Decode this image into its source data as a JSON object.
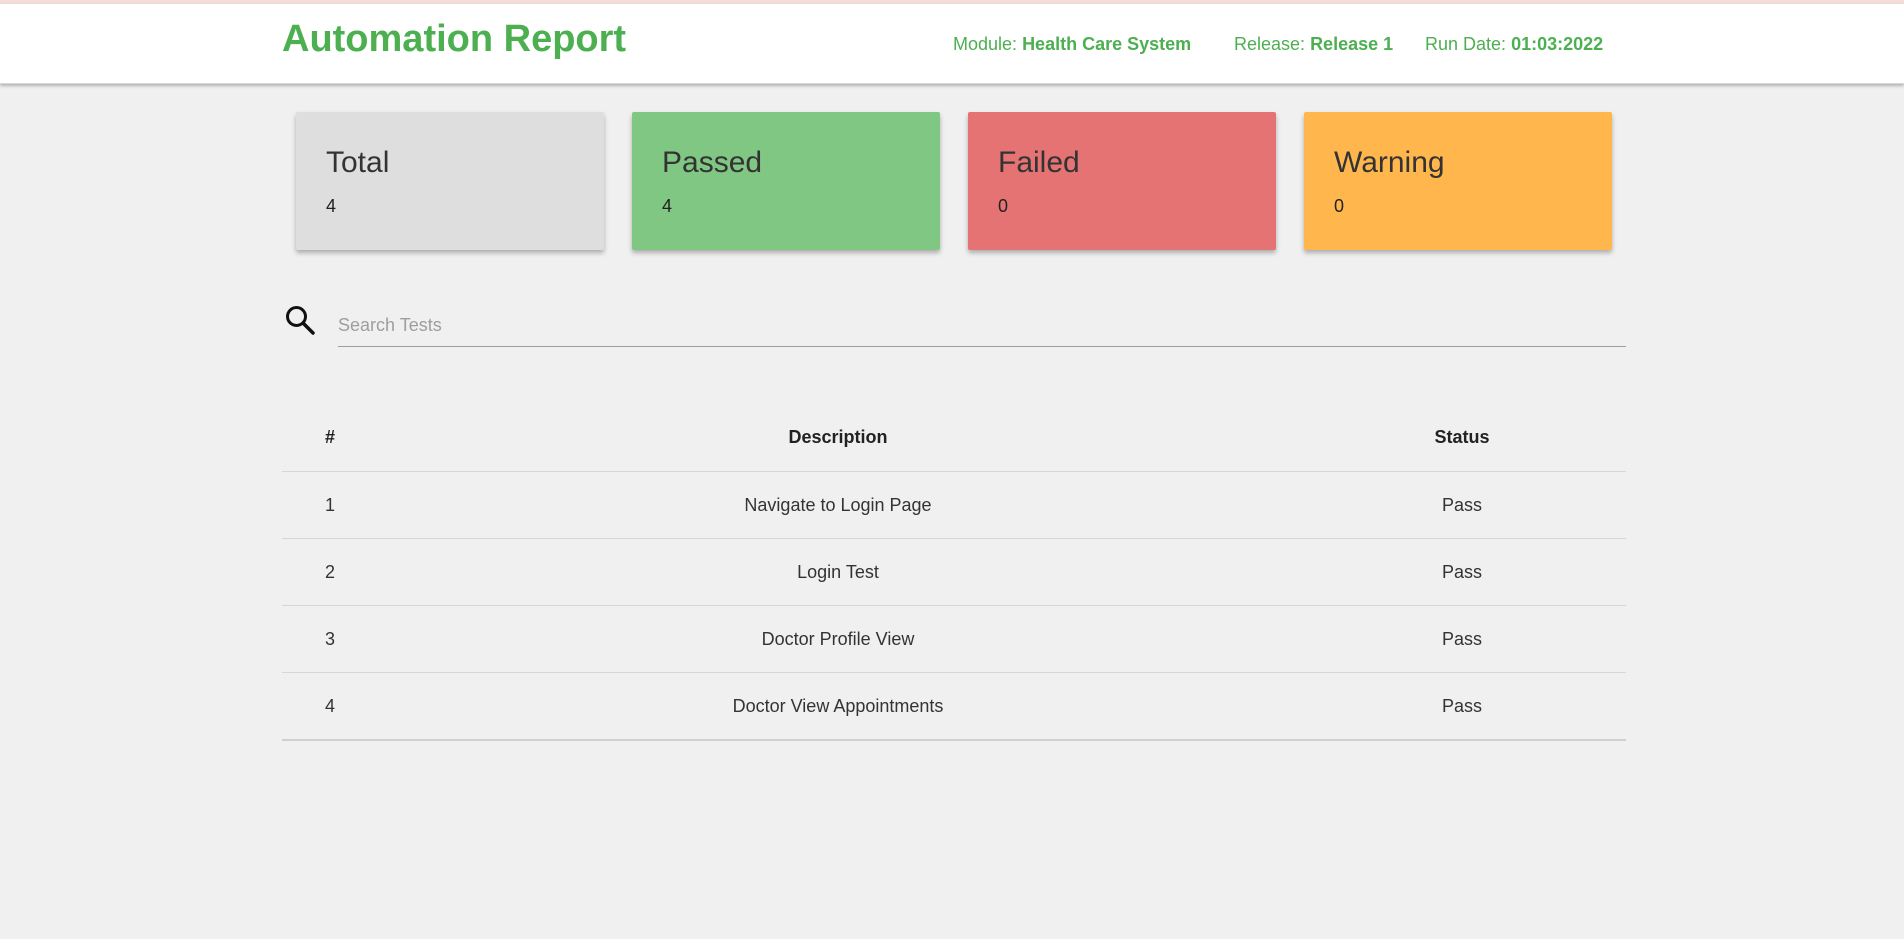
{
  "header": {
    "title": "Automation Report",
    "module_label": "Module:",
    "module_value": "Health Care System",
    "release_label": "Release:",
    "release_value": "Release 1",
    "rundate_label": "Run Date:",
    "rundate_value": "01:03:2022"
  },
  "summary": {
    "total": {
      "label": "Total",
      "value": "4",
      "color": "#dedede"
    },
    "passed": {
      "label": "Passed",
      "value": "4",
      "color": "#81c784"
    },
    "failed": {
      "label": "Failed",
      "value": "0",
      "color": "#e57373"
    },
    "warning": {
      "label": "Warning",
      "value": "0",
      "color": "#ffb74d"
    }
  },
  "search": {
    "icon": "search-icon",
    "placeholder": "Search Tests",
    "value": ""
  },
  "table": {
    "headers": {
      "num": "#",
      "description": "Description",
      "status": "Status"
    },
    "rows": [
      {
        "num": "1",
        "description": "Navigate to Login Page",
        "status": "Pass"
      },
      {
        "num": "2",
        "description": "Login Test",
        "status": "Pass"
      },
      {
        "num": "3",
        "description": "Doctor Profile View",
        "status": "Pass"
      },
      {
        "num": "4",
        "description": "Doctor View Appointments",
        "status": "Pass"
      }
    ]
  },
  "colors": {
    "accent": "#4caf50",
    "background": "#f0f0f0"
  }
}
